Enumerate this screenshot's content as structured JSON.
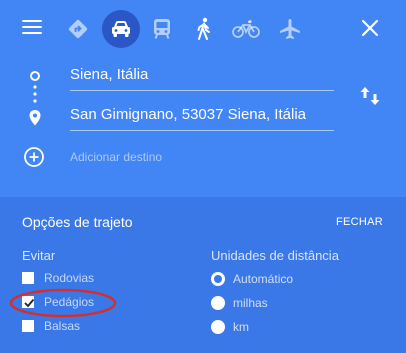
{
  "header": {
    "menu_icon": "hamburger-menu-icon",
    "close_icon": "close-icon"
  },
  "travel_modes": [
    {
      "name": "best-route",
      "icon": "directions-diamond-icon",
      "active": false
    },
    {
      "name": "car",
      "icon": "car-icon",
      "active": true
    },
    {
      "name": "transit",
      "icon": "train-icon",
      "active": false
    },
    {
      "name": "walking",
      "icon": "walking-person-icon",
      "active": false
    },
    {
      "name": "bicycle",
      "icon": "bicycle-icon",
      "active": false
    },
    {
      "name": "flight",
      "icon": "airplane-icon",
      "active": false
    }
  ],
  "route": {
    "origin": "Siena, Itália",
    "destination": "San Gimignano, 53037 Siena, Itália",
    "add_destination": "Adicionar destino",
    "swap_icon": "swap-vertical-icon",
    "add_icon": "plus-circle-icon"
  },
  "options": {
    "title": "Opções de trajeto",
    "close_label": "FECHAR",
    "avoid": {
      "heading": "Evitar",
      "items": [
        {
          "label": "Rodovias",
          "checked": false
        },
        {
          "label": "Pedágios",
          "checked": true
        },
        {
          "label": "Balsas",
          "checked": false
        }
      ]
    },
    "units": {
      "heading": "Unidades de distância",
      "items": [
        {
          "label": "Automático",
          "selected": true
        },
        {
          "label": "milhas",
          "selected": false
        },
        {
          "label": "km",
          "selected": false
        }
      ]
    }
  },
  "colors": {
    "header_bg": "#4285f4",
    "options_bg": "#3b78e7",
    "active_mode_bg": "#2a56c6",
    "annotation": "#d32f2f"
  }
}
